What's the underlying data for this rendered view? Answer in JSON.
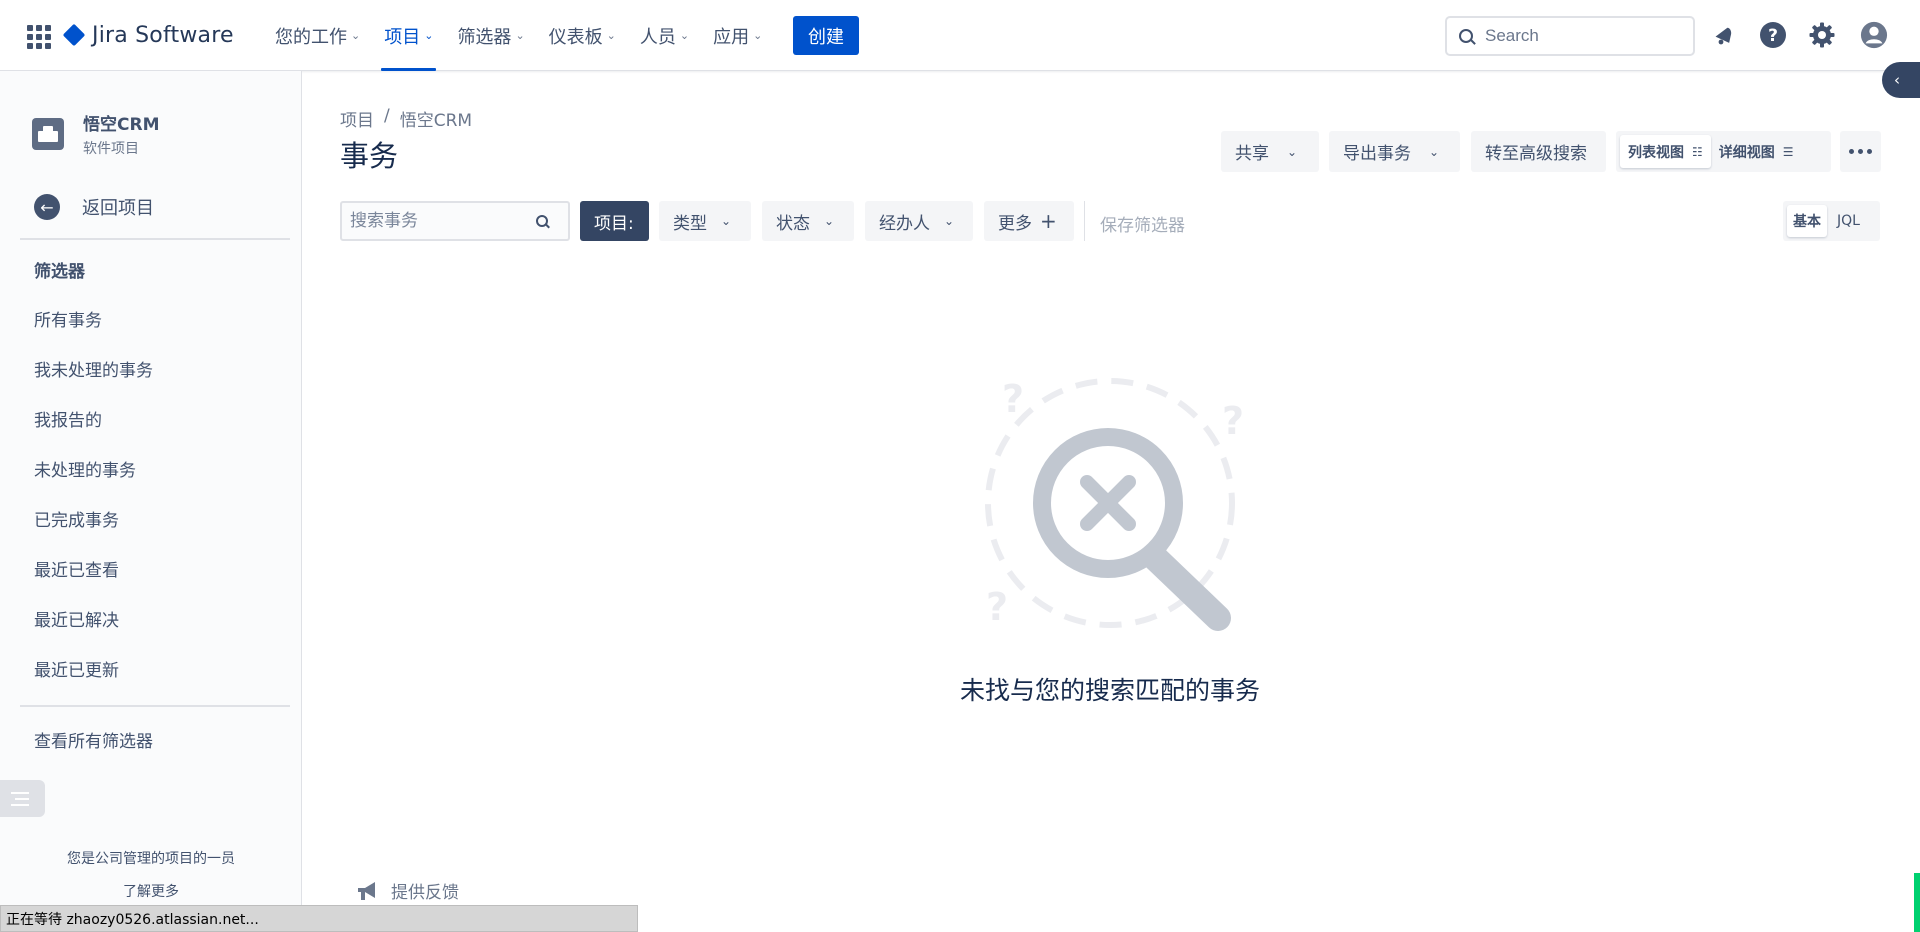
{
  "app": {
    "brand": "Jira Software",
    "accent_color": "#0052cc"
  },
  "topnav": {
    "items": [
      {
        "label": "您的工作",
        "active": false
      },
      {
        "label": "项目",
        "active": true
      },
      {
        "label": "筛选器",
        "active": false
      },
      {
        "label": "仪表板",
        "active": false
      },
      {
        "label": "人员",
        "active": false
      },
      {
        "label": "应用",
        "active": false
      }
    ],
    "create_label": "创建",
    "search_placeholder": "Search",
    "icons": [
      "notifications-icon",
      "help-icon",
      "settings-icon",
      "profile-icon"
    ]
  },
  "sidebar": {
    "project_name": "悟空CRM",
    "project_type": "软件项目",
    "back_label": "返回项目",
    "filters_heading": "筛选器",
    "items": [
      {
        "label": "所有事务"
      },
      {
        "label": "我未处理的事务"
      },
      {
        "label": "我报告的"
      },
      {
        "label": "未处理的事务"
      },
      {
        "label": "已完成事务"
      },
      {
        "label": "最近已查看"
      },
      {
        "label": "最近已解决"
      },
      {
        "label": "最近已更新"
      }
    ],
    "view_all_label": "查看所有筛选器",
    "member_text": "您是公司管理的项目的一员",
    "learn_more": "了解更多"
  },
  "main": {
    "breadcrumb": [
      "项目",
      "/",
      "悟空CRM"
    ],
    "title": "事务",
    "actions": {
      "share": "共享",
      "export": "导出事务",
      "advanced_search": "转至高级搜索",
      "list_view": "列表视图",
      "detail_view": "详细视图"
    },
    "filters": {
      "search_placeholder": "搜索事务",
      "project": "项目:",
      "type": "类型",
      "status": "状态",
      "assignee": "经办人",
      "more": "更多",
      "save_filter": "保存筛选器",
      "mode_basic": "基本",
      "mode_jql": "JQL"
    },
    "empty_message": "未找与您的搜索匹配的事务",
    "feedback": "提供反馈"
  },
  "statusbar": {
    "text": "正在等待 zhaozy0526.atlassian.net..."
  }
}
